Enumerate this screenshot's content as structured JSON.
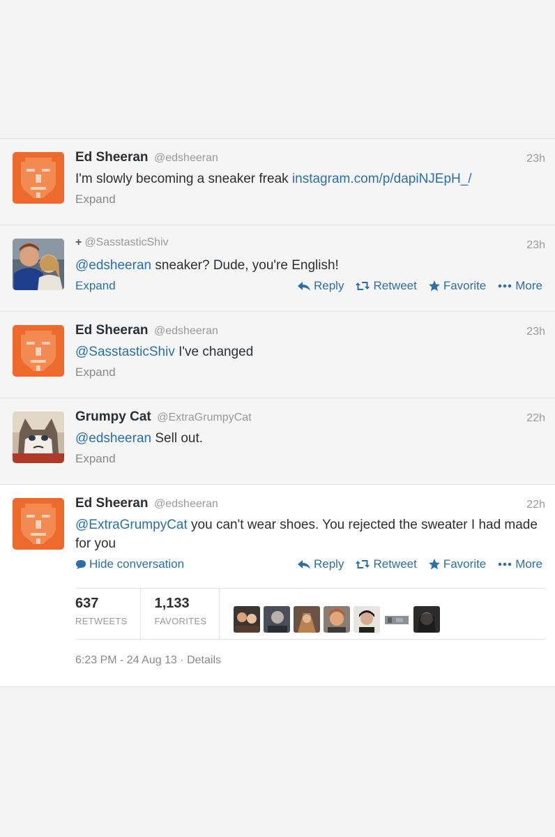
{
  "tweets": [
    {
      "fullname": "Ed Sheeran",
      "username": "@edsheeran",
      "time": "23h",
      "text": "I'm slowly becoming a sneaker freak ",
      "link": "instagram.com/p/dapiNJEpH_/",
      "expand_label": "Expand",
      "avatar": "ed-sheeran-orange-avatar"
    },
    {
      "plus": "+",
      "username": "@SasstasticShiv",
      "time": "23h",
      "mention": "@edsheeran",
      "text": " sneaker? Dude, you're English!",
      "expand_label": "Expand",
      "avatar": "couple-photo-avatar",
      "actions": {
        "reply": "Reply",
        "retweet": "Retweet",
        "favorite": "Favorite",
        "more": "More"
      }
    },
    {
      "fullname": "Ed Sheeran",
      "username": "@edsheeran",
      "time": "23h",
      "mention": "@SasstasticShiv",
      "text": " I've changed",
      "expand_label": "Expand",
      "avatar": "ed-sheeran-orange-avatar"
    },
    {
      "fullname": "Grumpy Cat",
      "username": "@ExtraGrumpyCat",
      "time": "22h",
      "mention": "@edsheeran",
      "text": " Sell out.",
      "expand_label": "Expand",
      "avatar": "grumpy-cat-avatar"
    },
    {
      "fullname": "Ed Sheeran",
      "username": "@edsheeran",
      "time": "22h",
      "mention": "@ExtraGrumpyCat",
      "text": " you can't wear shoes. You rejected the sweater I had made for you",
      "hide_label": "Hide conversation",
      "avatar": "ed-sheeran-orange-avatar",
      "actions": {
        "reply": "Reply",
        "retweet": "Retweet",
        "favorite": "Favorite",
        "more": "More"
      },
      "stats": {
        "retweets_count": "637",
        "retweets_label": "RETWEETS",
        "favorites_count": "1,133",
        "favorites_label": "FAVORITES"
      },
      "timestamp": "6:23 PM - 24 Aug 13",
      "separator": " · ",
      "details_label": "Details"
    }
  ],
  "colors": {
    "link": "#2a6fa8",
    "avatar_orange": "#ee6a2c",
    "background": "#f3f3f3"
  }
}
